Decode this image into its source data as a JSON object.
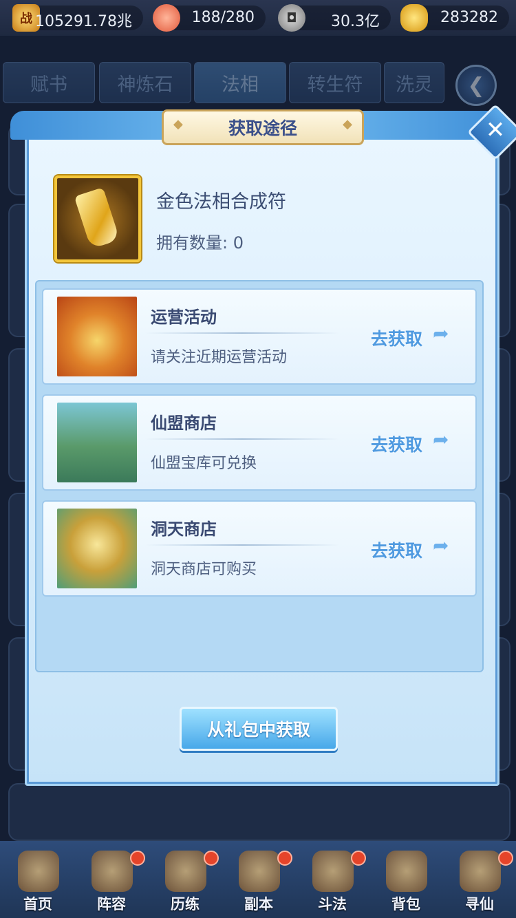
{
  "resources": [
    {
      "icon": "power-icon",
      "value": "105291.78兆"
    },
    {
      "icon": "peach-icon",
      "value": "188/280"
    },
    {
      "icon": "copper-coin-icon",
      "value": "30.3亿"
    },
    {
      "icon": "gold-ingot-icon",
      "value": "283282"
    }
  ],
  "power_badge": "战",
  "tabs": [
    "赋书",
    "神炼石",
    "法相",
    "转生符",
    "洗灵"
  ],
  "active_tab": "法相",
  "dialog": {
    "title": "获取途径",
    "item_name": "金色法相合成符",
    "owned_label": "拥有数量:",
    "owned_count": "0",
    "sources": [
      {
        "name": "运营活动",
        "desc": "请关注近期运营活动",
        "action": "去获取",
        "thumb": "gift-bag-icon"
      },
      {
        "name": "仙盟商店",
        "desc": "仙盟宝库可兑换",
        "action": "去获取",
        "thumb": "mountain-pavilion-icon"
      },
      {
        "name": "洞天商店",
        "desc": "洞天商店可购买",
        "action": "去获取",
        "thumb": "shop-pavilion-icon"
      }
    ],
    "gift_button": "从礼包中获取"
  },
  "nav": [
    {
      "label": "首页",
      "badge": false
    },
    {
      "label": "阵容",
      "badge": true
    },
    {
      "label": "历练",
      "badge": true
    },
    {
      "label": "副本",
      "badge": true
    },
    {
      "label": "斗法",
      "badge": true
    },
    {
      "label": "背包",
      "badge": false
    },
    {
      "label": "寻仙",
      "badge": true
    }
  ]
}
